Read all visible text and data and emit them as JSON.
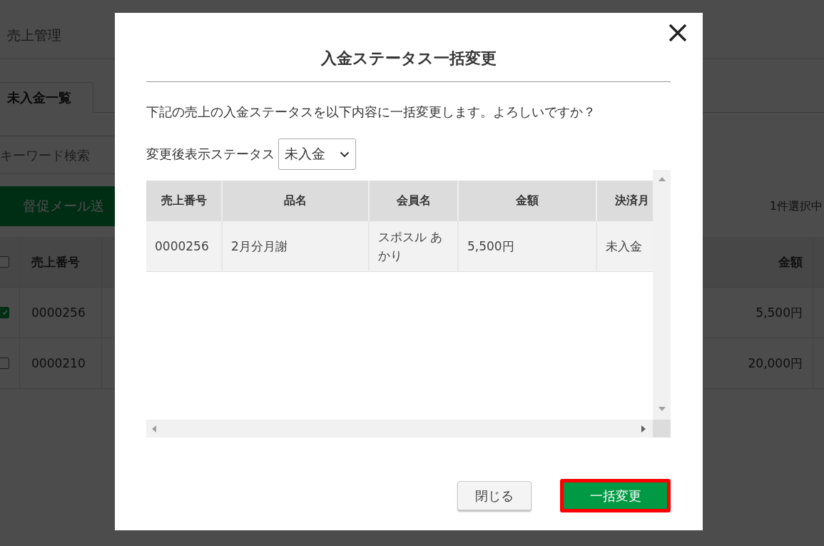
{
  "background_page": {
    "nav_tabs": [
      {
        "label": "売上管理"
      }
    ],
    "sub_tabs": [
      {
        "label": "未入金一覧",
        "selected": true
      }
    ],
    "search": {
      "placeholder": "キーワード検索"
    },
    "reminder_button": {
      "label": "督促メール送"
    },
    "selection_count": "1件選択中",
    "table": {
      "header_checked": false,
      "columns": [
        "売上番号",
        "金額"
      ],
      "rows": [
        {
          "checked": true,
          "number": "0000256",
          "amount": "5,500円"
        },
        {
          "checked": false,
          "number": "0000210",
          "amount": "20,000円"
        }
      ]
    }
  },
  "dialog": {
    "title": "入金ステータス一括変更",
    "message": "下記の売上の入金ステータスを以下内容に一括変更します。よろしいですか？",
    "status_label": "変更後表示ステータス",
    "status_select": {
      "value": "未入金"
    },
    "table": {
      "columns": [
        "売上番号",
        "品名",
        "会員名",
        "金額",
        "決済月"
      ],
      "rows": [
        [
          "0000256",
          "2月分月謝",
          "スポスル あかり",
          "5,500円",
          "未入金"
        ]
      ]
    },
    "buttons": [
      {
        "label": "閉じる",
        "kind": "secondary",
        "highlighted": false
      },
      {
        "label": "一括変更",
        "kind": "primary",
        "highlighted": true
      }
    ]
  }
}
